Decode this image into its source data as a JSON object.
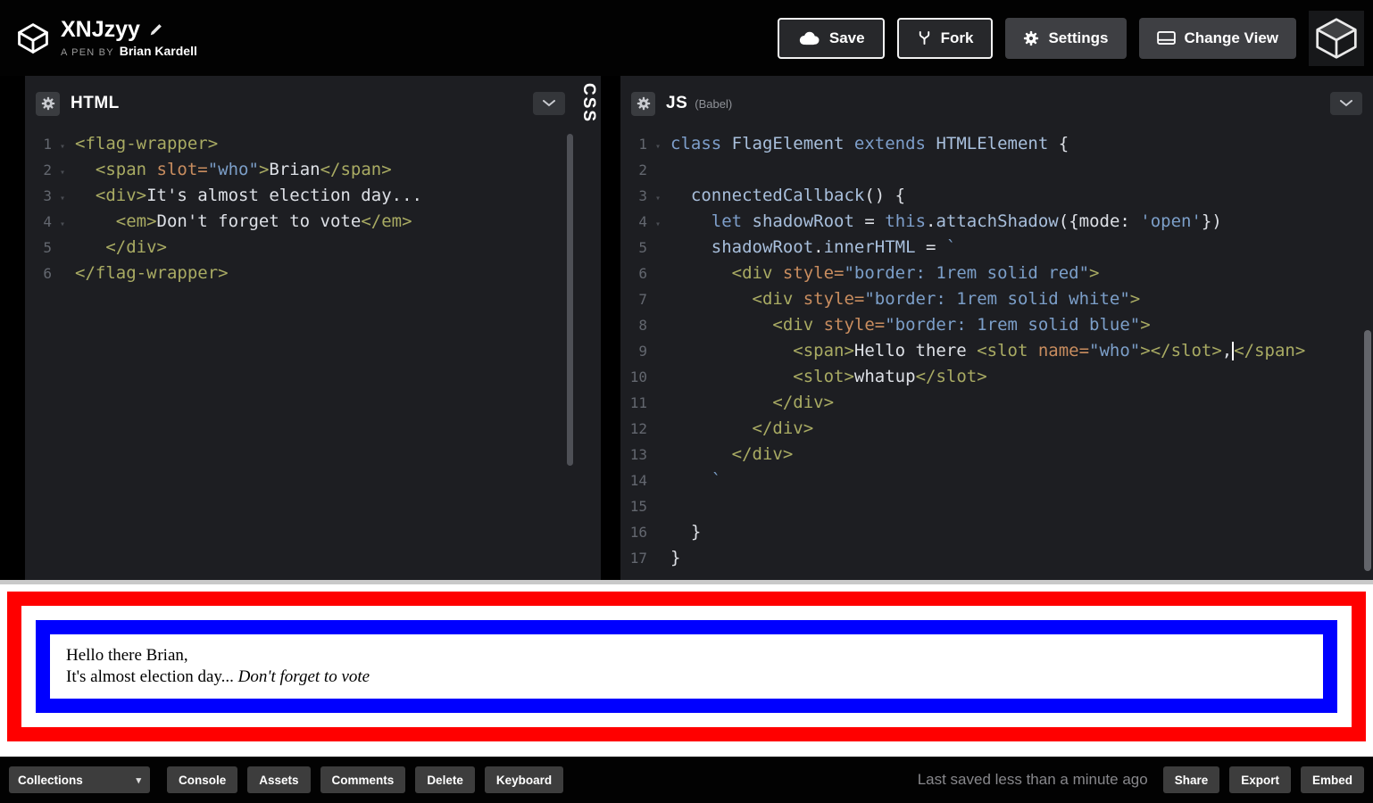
{
  "header": {
    "title": "XNJzyy",
    "byline_prefix": "A PEN BY",
    "author": "Brian Kardell",
    "save_label": "Save",
    "fork_label": "Fork",
    "settings_label": "Settings",
    "change_view_label": "Change View"
  },
  "icons": {
    "logo": "codepen-cube",
    "edit": "pencil",
    "save": "cloud",
    "fork": "fork",
    "settings": "gear",
    "change_view": "monitor",
    "collapse": "chevron-down",
    "fold": "▾",
    "dropdown_caret": "▾",
    "avatar": "dark-cube"
  },
  "colors": {
    "editor_bg": "#1d1e22",
    "flag_red": "#ff0000",
    "flag_blue": "#0000ff",
    "syntax_tag": "#a9ab63",
    "syntax_attr": "#c98d5f",
    "syntax_string": "#7c9fc9",
    "syntax_keyword": "#7e9fcb",
    "syntax_identifier": "#a8bfdc"
  },
  "editors": {
    "html": {
      "label": "HTML",
      "lines": [
        {
          "n": 1,
          "f": true,
          "s": [
            [
              "tag",
              "<flag-wrapper>"
            ]
          ]
        },
        {
          "n": 2,
          "f": true,
          "s": [
            [
              "pln",
              "  "
            ],
            [
              "tag",
              "<span "
            ],
            [
              "attr",
              "slot="
            ],
            [
              "str",
              "\"who\""
            ],
            [
              "tag",
              ">"
            ],
            [
              "pln",
              "Brian"
            ],
            [
              "tag",
              "</span>"
            ]
          ]
        },
        {
          "n": 3,
          "f": true,
          "s": [
            [
              "pln",
              "  "
            ],
            [
              "tag",
              "<div>"
            ],
            [
              "pln",
              "It's almost election day..."
            ]
          ]
        },
        {
          "n": 4,
          "f": true,
          "s": [
            [
              "pln",
              "    "
            ],
            [
              "tag",
              "<em>"
            ],
            [
              "pln",
              "Don't forget to vote"
            ],
            [
              "tag",
              "</em>"
            ]
          ]
        },
        {
          "n": 5,
          "f": false,
          "s": [
            [
              "pln",
              "   "
            ],
            [
              "tag",
              "</div>"
            ]
          ]
        },
        {
          "n": 6,
          "f": false,
          "s": [
            [
              "tag",
              "</flag-wrapper>"
            ]
          ]
        }
      ]
    },
    "css": {
      "label": "CSS"
    },
    "js": {
      "label": "JS",
      "sublabel": "(Babel)",
      "lines": [
        {
          "n": 1,
          "f": true,
          "s": [
            [
              "kw",
              "class "
            ],
            [
              "id",
              "FlagElement "
            ],
            [
              "kw",
              "extends "
            ],
            [
              "id",
              "HTMLElement "
            ],
            [
              "pln",
              "{"
            ]
          ]
        },
        {
          "n": 2,
          "f": false,
          "s": []
        },
        {
          "n": 3,
          "f": true,
          "s": [
            [
              "pln",
              "  "
            ],
            [
              "id",
              "connectedCallback"
            ],
            [
              "pln",
              "() {"
            ]
          ]
        },
        {
          "n": 4,
          "f": true,
          "s": [
            [
              "pln",
              "    "
            ],
            [
              "kw",
              "let "
            ],
            [
              "id",
              "shadowRoot"
            ],
            [
              "pln",
              " = "
            ],
            [
              "kw",
              "this"
            ],
            [
              "pln",
              "."
            ],
            [
              "id",
              "attachShadow"
            ],
            [
              "pln",
              "({mode: "
            ],
            [
              "str",
              "'open'"
            ],
            [
              "pln",
              "})"
            ]
          ]
        },
        {
          "n": 5,
          "f": false,
          "s": [
            [
              "pln",
              "    "
            ],
            [
              "id",
              "shadowRoot"
            ],
            [
              "pln",
              "."
            ],
            [
              "id",
              "innerHTML"
            ],
            [
              "pln",
              " = "
            ],
            [
              "str",
              "`"
            ]
          ]
        },
        {
          "n": 6,
          "f": false,
          "s": [
            [
              "pln",
              "      "
            ],
            [
              "tag",
              "<div "
            ],
            [
              "attr",
              "style="
            ],
            [
              "str",
              "\"border: 1rem solid red\""
            ],
            [
              "tag",
              ">"
            ]
          ]
        },
        {
          "n": 7,
          "f": false,
          "s": [
            [
              "pln",
              "        "
            ],
            [
              "tag",
              "<div "
            ],
            [
              "attr",
              "style="
            ],
            [
              "str",
              "\"border: 1rem solid white\""
            ],
            [
              "tag",
              ">"
            ]
          ]
        },
        {
          "n": 8,
          "f": false,
          "s": [
            [
              "pln",
              "          "
            ],
            [
              "tag",
              "<div "
            ],
            [
              "attr",
              "style="
            ],
            [
              "str",
              "\"border: 1rem solid blue\""
            ],
            [
              "tag",
              ">"
            ]
          ]
        },
        {
          "n": 9,
          "f": false,
          "s": [
            [
              "pln",
              "            "
            ],
            [
              "tag",
              "<span>"
            ],
            [
              "pln",
              "Hello there "
            ],
            [
              "tag",
              "<slot "
            ],
            [
              "attr",
              "name="
            ],
            [
              "str",
              "\"who\""
            ],
            [
              "tag",
              "></slot>"
            ],
            [
              "pln",
              ","
            ],
            [
              "cur",
              ""
            ],
            [
              "tag",
              "</span>"
            ]
          ]
        },
        {
          "n": 10,
          "f": false,
          "s": [
            [
              "pln",
              "            "
            ],
            [
              "tag",
              "<slot>"
            ],
            [
              "pln",
              "whatup"
            ],
            [
              "tag",
              "</slot>"
            ]
          ]
        },
        {
          "n": 11,
          "f": false,
          "s": [
            [
              "pln",
              "          "
            ],
            [
              "tag",
              "</div>"
            ]
          ]
        },
        {
          "n": 12,
          "f": false,
          "s": [
            [
              "pln",
              "        "
            ],
            [
              "tag",
              "</div>"
            ]
          ]
        },
        {
          "n": 13,
          "f": false,
          "s": [
            [
              "pln",
              "      "
            ],
            [
              "tag",
              "</div>"
            ]
          ]
        },
        {
          "n": 14,
          "f": false,
          "s": [
            [
              "pln",
              "    "
            ],
            [
              "str",
              "`"
            ]
          ]
        },
        {
          "n": 15,
          "f": false,
          "s": []
        },
        {
          "n": 16,
          "f": false,
          "s": [
            [
              "pln",
              "  }"
            ]
          ]
        },
        {
          "n": 17,
          "f": false,
          "s": [
            [
              "pln",
              "}"
            ]
          ]
        }
      ]
    }
  },
  "preview": {
    "greeting": "Hello there Brian,",
    "message": "It's almost election day... ",
    "emphasis": "Don't forget to vote"
  },
  "footer": {
    "collections_label": "Collections",
    "buttons": [
      "Console",
      "Assets",
      "Comments",
      "Delete",
      "Keyboard"
    ],
    "status": "Last saved less than a minute ago",
    "right_buttons": [
      "Share",
      "Export",
      "Embed"
    ]
  }
}
